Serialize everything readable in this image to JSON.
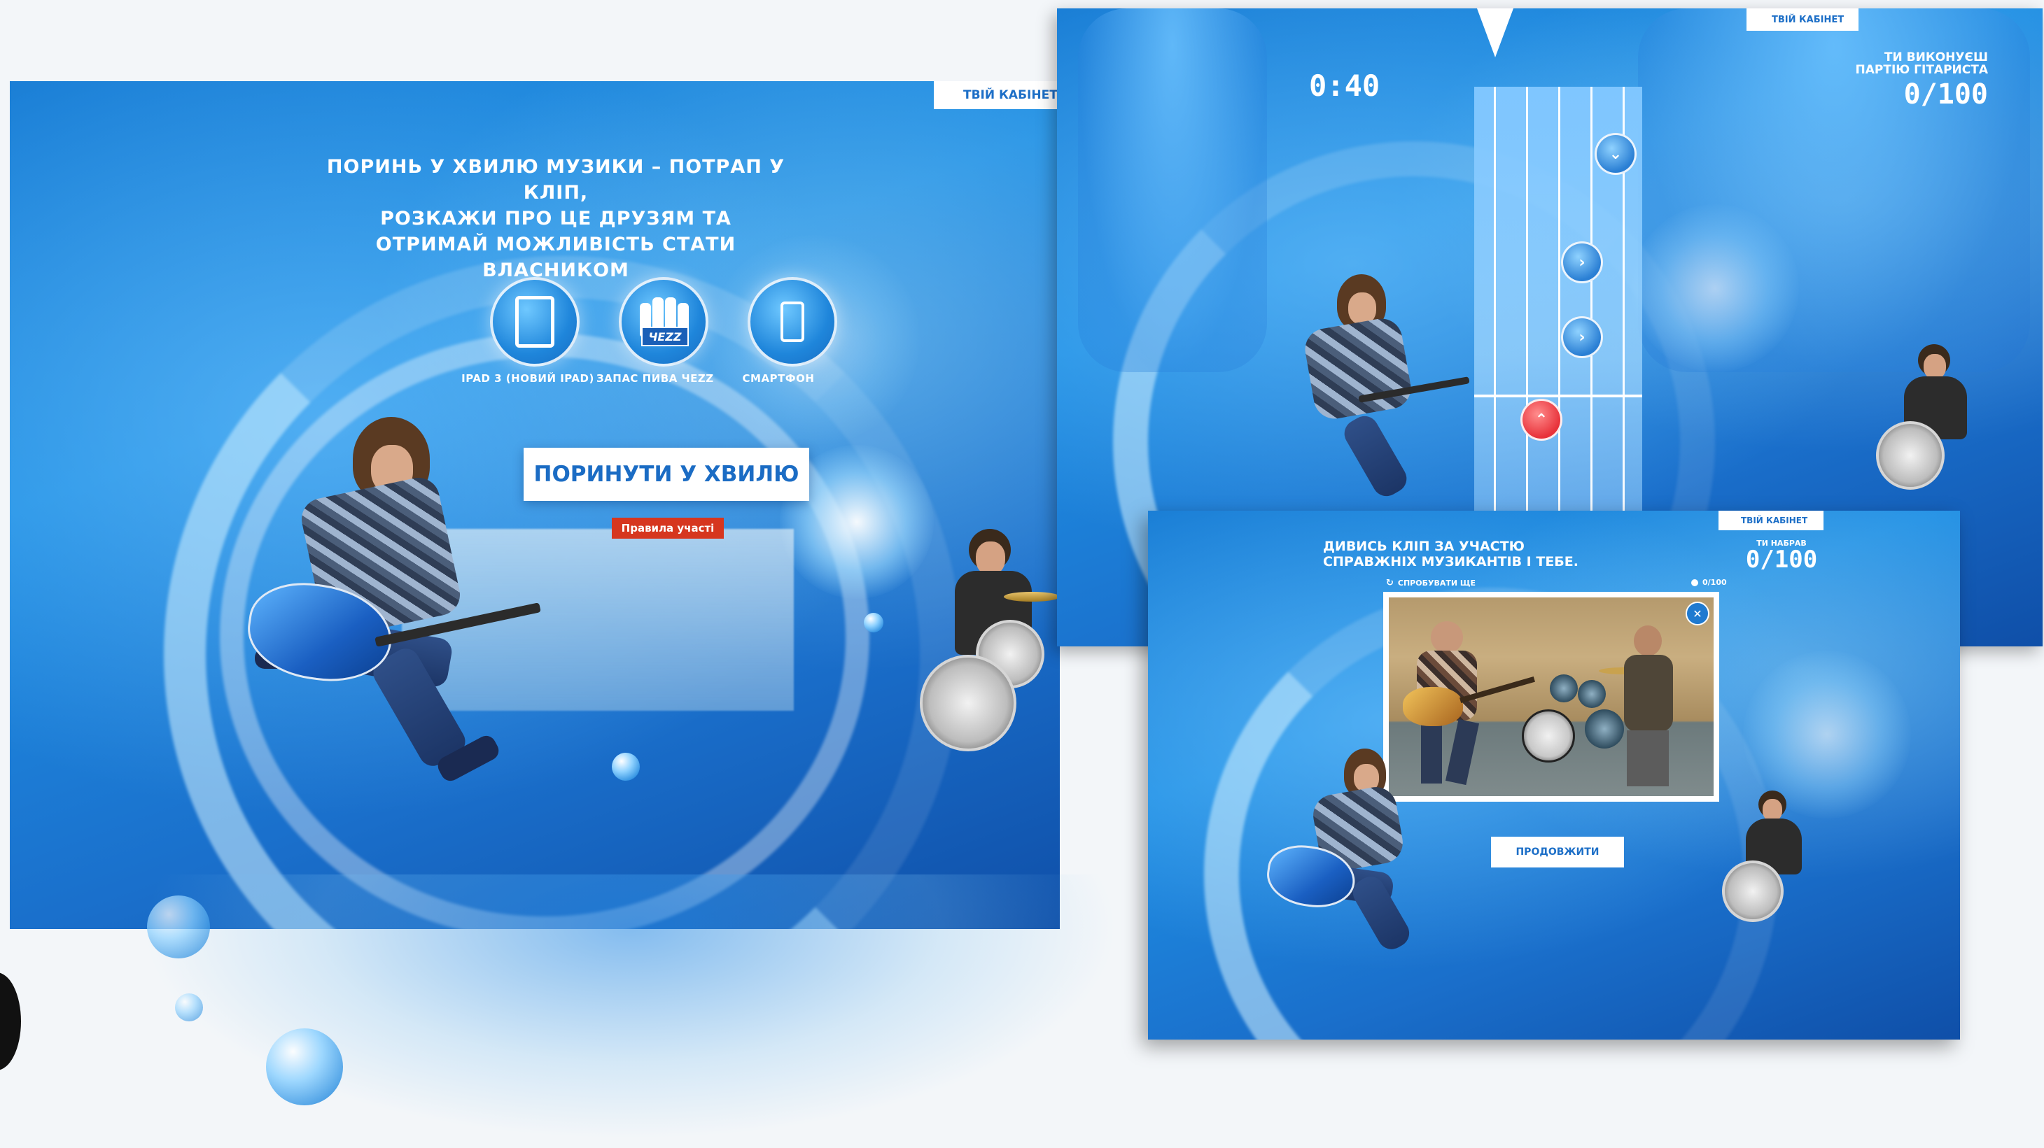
{
  "colors": {
    "accent_blue": "#1d6fc7",
    "background_blue": "#1f8fe4",
    "rules_red": "#d6361f",
    "note_red": "#e8323a",
    "white": "#ffffff"
  },
  "panel1": {
    "cabinet": {
      "label": "ТВІЙ КАБІНЕТ",
      "icon": "person-icon"
    },
    "headline": [
      "ПОРИНЬ У ХВИЛЮ МУЗИКИ – ПОТРАП У КЛІП,",
      "РОЗКАЖИ ПРО ЦЕ ДРУЗЯМ ТА",
      "ОТРИМАЙ МОЖЛИВІСТЬ СТАТИ ВЛАСНИКОМ"
    ],
    "prizes": [
      {
        "label": "IPAD 3 (НОВИЙ IPAD)",
        "icon": "tablet-icon"
      },
      {
        "label": "ЗАПАС ПИВА ЧЕZZ",
        "icon": "beer-bottles-icon",
        "badge": "ЧЕZZ"
      },
      {
        "label": "СМАРТФОН",
        "icon": "smartphone-icon"
      }
    ],
    "main_button": "ПОРИНУТИ У ХВИЛЮ",
    "rules_button": "Правила участі"
  },
  "panel2": {
    "cabinet": {
      "label": "ТВІЙ КАБІНЕТ",
      "icon": "person-icon"
    },
    "timer": "0:40",
    "role_label": [
      "ТИ ВИКОНУЄШ",
      "ПАРТІЮ ГІТАРИСТА"
    ],
    "score": "0/100",
    "notes": [
      {
        "icon": "chevron-down-icon",
        "glyph": "⌄",
        "color": "blue"
      },
      {
        "icon": "chevron-right-icon",
        "glyph": "›",
        "color": "blue"
      },
      {
        "icon": "chevron-right-icon",
        "glyph": "›",
        "color": "blue"
      },
      {
        "icon": "chevron-up-icon",
        "glyph": "⌃",
        "color": "red"
      }
    ]
  },
  "panel3": {
    "cabinet": {
      "label": "ТВІЙ КАБІНЕТ",
      "icon": "person-icon"
    },
    "title": [
      "ДИВИСЬ КЛІП ЗА УЧАСТЮ",
      "СПРАВЖНІХ МУЗИКАНТІВ І ТЕБЕ."
    ],
    "score_caption": "ТИ НАБРАВ",
    "score": "0/100",
    "try_again": "СПРОБУВАТИ ЩЕ",
    "small_score": "0/100",
    "share_icon": "share-icon",
    "continue_button": "ПРОДОВЖИТИ"
  }
}
